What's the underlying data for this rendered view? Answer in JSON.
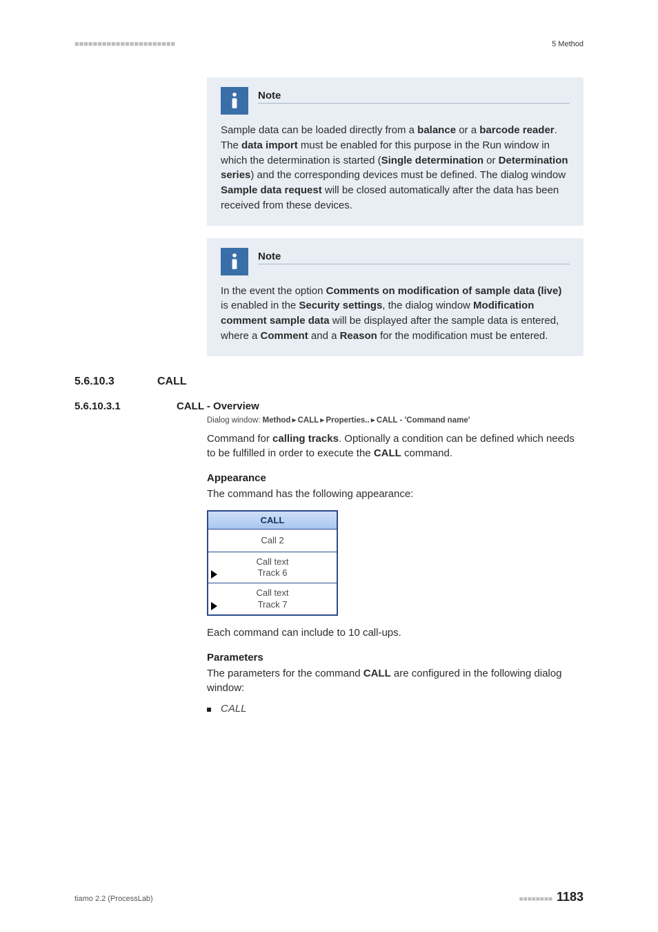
{
  "header": {
    "dots": "■■■■■■■■■■■■■■■■■■■■■■",
    "right": "5 Method"
  },
  "note1": {
    "title": "Note",
    "body_parts": [
      "Sample data can be loaded directly from a ",
      "balance",
      " or a ",
      "barcode reader",
      ". The ",
      "data import",
      " must be enabled for this purpose in the Run window in which the determination is started (",
      "Single determination",
      " or ",
      "Determination series",
      ") and the corresponding devices must be defined. The dialog window ",
      "Sample data request",
      " will be closed automatically after the data has been received from these devices."
    ]
  },
  "note2": {
    "title": "Note",
    "body_parts": [
      "In the event the option ",
      "Comments on modification of sample data (live)",
      " is enabled in the ",
      "Security settings",
      ", the dialog window ",
      "Modification comment sample data",
      " will be displayed after the sample data is entered, where a ",
      "Comment",
      " and a ",
      "Reason",
      " for the modification must be entered."
    ]
  },
  "section": {
    "num": "5.6.10.3",
    "title": "CALL"
  },
  "subsection": {
    "num": "5.6.10.3.1",
    "title": "CALL - Overview"
  },
  "dialog": {
    "prefix": "Dialog window: ",
    "crumbs": [
      "Method",
      "CALL",
      "Properties..",
      "CALL - 'Command name'"
    ]
  },
  "intro": {
    "p1_a": "Command for ",
    "p1_b": "calling tracks",
    "p1_c": ". Optionally a condition can be defined which needs to be fulfilled in order to execute the ",
    "p1_d": "CALL",
    "p1_e": " command."
  },
  "appearance": {
    "heading": "Appearance",
    "text": "The command has the following appearance:"
  },
  "call_block": {
    "header": "CALL",
    "rows": [
      {
        "lines": [
          "Call 2"
        ],
        "arrow": false
      },
      {
        "lines": [
          "Call text",
          "Track 6"
        ],
        "arrow": true
      },
      {
        "lines": [
          "Call text",
          "Track 7"
        ],
        "arrow": true
      }
    ]
  },
  "after_block": "Each command can include to 10 call-ups.",
  "parameters": {
    "heading": "Parameters",
    "text_a": "The parameters for the command ",
    "text_b": "CALL",
    "text_c": " are configured in the following dialog window:",
    "bullet": "CALL"
  },
  "footer": {
    "left": "tiamo 2.2 (ProcessLab)",
    "dots": "■■■■■■■■",
    "page": "1183"
  }
}
